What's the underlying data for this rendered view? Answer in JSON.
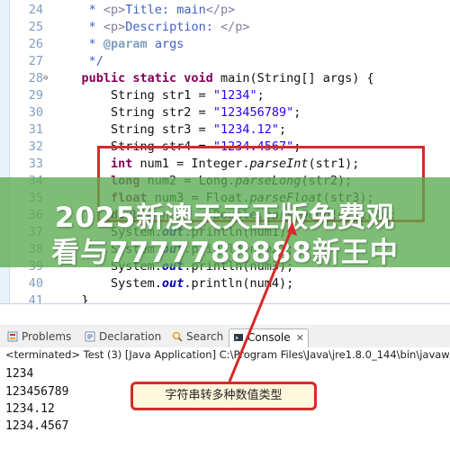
{
  "editor": {
    "lines": [
      {
        "num": "24",
        "tokens": [
          [
            "doc",
            "     * "
          ],
          [
            "tag",
            "<p>"
          ],
          [
            "doc",
            "Title: main"
          ],
          [
            "tag",
            "</p>"
          ]
        ]
      },
      {
        "num": "25",
        "tokens": [
          [
            "doc",
            "     * "
          ],
          [
            "tag",
            "<p>"
          ],
          [
            "doc",
            "Description: "
          ],
          [
            "tag",
            "</p>"
          ]
        ]
      },
      {
        "num": "26",
        "tokens": [
          [
            "doc",
            "     * "
          ],
          [
            "ann",
            "@param"
          ],
          [
            "doc",
            " args"
          ]
        ]
      },
      {
        "num": "27",
        "tokens": [
          [
            "doc",
            "     */"
          ]
        ]
      },
      {
        "num": "28",
        "fold": true,
        "tokens": [
          [
            "kw",
            "    public static void "
          ],
          [
            "",
            "main(String[] args) {"
          ]
        ]
      },
      {
        "num": "29",
        "tokens": [
          [
            "",
            "        String str1 = "
          ],
          [
            "str",
            "\"1234\""
          ],
          [
            "",
            ";"
          ]
        ]
      },
      {
        "num": "30",
        "tokens": [
          [
            "",
            "        String str2 = "
          ],
          [
            "str",
            "\"123456789\""
          ],
          [
            "",
            ";"
          ]
        ]
      },
      {
        "num": "31",
        "tokens": [
          [
            "",
            "        String str3 = "
          ],
          [
            "str",
            "\"1234.12\""
          ],
          [
            "",
            ";"
          ]
        ]
      },
      {
        "num": "32",
        "tokens": [
          [
            "",
            "        String str4 = "
          ],
          [
            "str",
            "\"1234.4567\""
          ],
          [
            "",
            ";"
          ]
        ]
      },
      {
        "num": "33",
        "tokens": [
          [
            "kw",
            "        int"
          ],
          [
            "",
            " num1 = Integer."
          ],
          [
            "sm",
            "parseInt"
          ],
          [
            "",
            "(str1);"
          ]
        ]
      },
      {
        "num": "34",
        "tokens": [
          [
            "kw",
            "        long"
          ],
          [
            "",
            " num2 = Long."
          ],
          [
            "sm",
            "parseLong"
          ],
          [
            "",
            "(str2);"
          ]
        ]
      },
      {
        "num": "35",
        "tokens": [
          [
            "kw",
            "        float"
          ],
          [
            "",
            " num3 = Float."
          ],
          [
            "sm",
            "parseFloat"
          ],
          [
            "",
            "(str3);"
          ]
        ]
      },
      {
        "num": "36",
        "tokens": [
          [
            "kw",
            "        double"
          ],
          [
            "",
            " num4 = Double."
          ],
          [
            "sm",
            "parseDouble"
          ],
          [
            "",
            "(str4);"
          ]
        ]
      },
      {
        "num": "37",
        "tokens": [
          [
            "",
            "        System."
          ],
          [
            "fld",
            "out"
          ],
          [
            "",
            ".println(num1);"
          ]
        ]
      },
      {
        "num": "38",
        "tokens": [
          [
            "",
            "        System."
          ],
          [
            "fld",
            "out"
          ],
          [
            "",
            ".println(num2);"
          ]
        ]
      },
      {
        "num": "39",
        "tokens": [
          [
            "",
            "        System."
          ],
          [
            "fld",
            "out"
          ],
          [
            "",
            ".println(num3);"
          ]
        ]
      },
      {
        "num": "40",
        "tokens": [
          [
            "",
            "        System."
          ],
          [
            "fld",
            "out"
          ],
          [
            "",
            ".println(num4);"
          ]
        ]
      },
      {
        "num": "41",
        "tokens": [
          [
            "",
            "    }"
          ]
        ]
      }
    ]
  },
  "watermark": {
    "line1": "2025新澳天天正版免费观",
    "line2": "看与7777788888新王中"
  },
  "tabs": [
    {
      "label": "Problems",
      "icon": "problems-icon"
    },
    {
      "label": "Declaration",
      "icon": "declaration-icon"
    },
    {
      "label": "Search",
      "icon": "search-icon"
    },
    {
      "label": "Console",
      "icon": "console-icon",
      "active": true,
      "close": "✕"
    }
  ],
  "console": {
    "terminated": "<terminated> Test (3) [Java Application] C:\\Program Files\\Java\\jre1.8.0_144\\bin\\javaw.exe",
    "output": [
      "1234",
      "123456789",
      "1234.12",
      "1234.4567"
    ]
  },
  "callout": {
    "text": "字符串转多种数值类型"
  },
  "colors": {
    "highlight": "#d62a2a",
    "keyword": "#7f0055",
    "string": "#2a00ff",
    "watermark": "#5aaa50"
  }
}
